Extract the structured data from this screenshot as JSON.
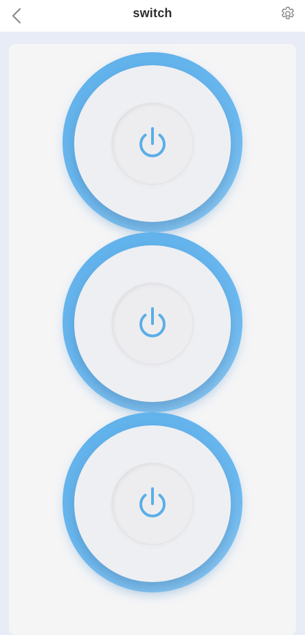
{
  "header": {
    "title": "switch",
    "back_icon": "chevron-left-icon",
    "settings_icon": "gear-icon"
  },
  "switches": [
    {
      "icon": "power-icon"
    },
    {
      "icon": "power-icon"
    },
    {
      "icon": "power-icon"
    }
  ],
  "colors": {
    "accent": "#5fb0ea",
    "background": "#e8ecf7",
    "panel": "#f5f5f6"
  }
}
